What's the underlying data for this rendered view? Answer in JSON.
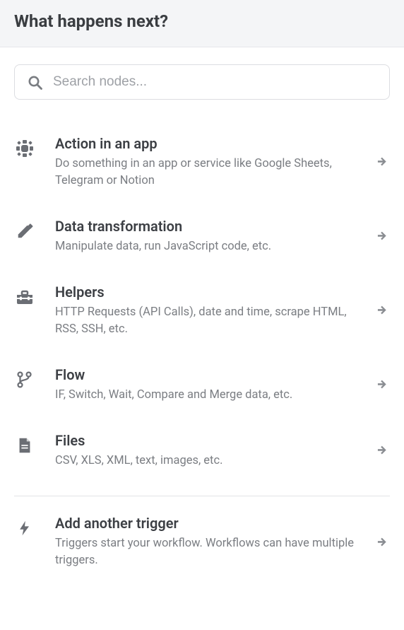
{
  "header": {
    "title": "What happens next?"
  },
  "search": {
    "placeholder": "Search nodes..."
  },
  "categories": [
    {
      "icon": "globe-icon",
      "title": "Action in an app",
      "desc": "Do something in an app or service like Google Sheets, Telegram or Notion"
    },
    {
      "icon": "pencil-icon",
      "title": "Data transformation",
      "desc": "Manipulate data, run JavaScript code, etc."
    },
    {
      "icon": "toolbox-icon",
      "title": "Helpers",
      "desc": "HTTP Requests (API Calls), date and time, scrape HTML, RSS, SSH, etc."
    },
    {
      "icon": "branch-icon",
      "title": "Flow",
      "desc": "IF, Switch, Wait, Compare and Merge data, etc."
    },
    {
      "icon": "file-icon",
      "title": "Files",
      "desc": "CSV, XLS, XML, text, images, etc."
    }
  ],
  "trigger": {
    "icon": "bolt-icon",
    "title": "Add another trigger",
    "desc": "Triggers start your workflow. Workflows can have multiple triggers."
  }
}
